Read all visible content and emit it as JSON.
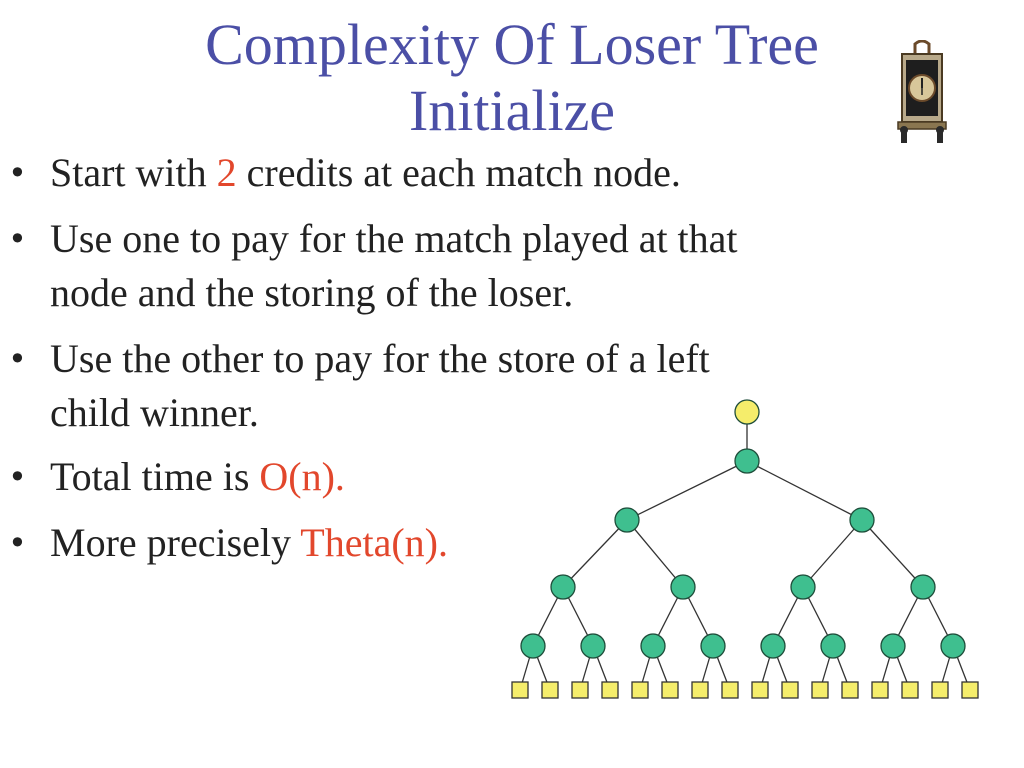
{
  "title": {
    "line1": "Complexity Of Loser Tree",
    "line2": "Initialize"
  },
  "bullets": [
    {
      "pre": "Start with ",
      "hl": "2",
      "post": " credits at each match node."
    },
    {
      "line1": "Use one to pay for the match played at that",
      "line2": "node and the storing of the loser."
    },
    {
      "line1": "Use the other to pay for the store of a left",
      "line2": "child winner."
    },
    {
      "pre": "Total time is ",
      "hl": "O(n)."
    },
    {
      "pre": "More precisely ",
      "hl": "Theta(n)."
    }
  ],
  "icons": {
    "clock": "clock-icon"
  },
  "colors": {
    "title": "#4b4fa6",
    "highlight": "#e2472c",
    "root_node": "#f5ed6b",
    "match_node": "#3fbf8f",
    "leaf_node": "#f5ed6b"
  },
  "tree": {
    "internal_levels": 4,
    "leaves": 16
  }
}
